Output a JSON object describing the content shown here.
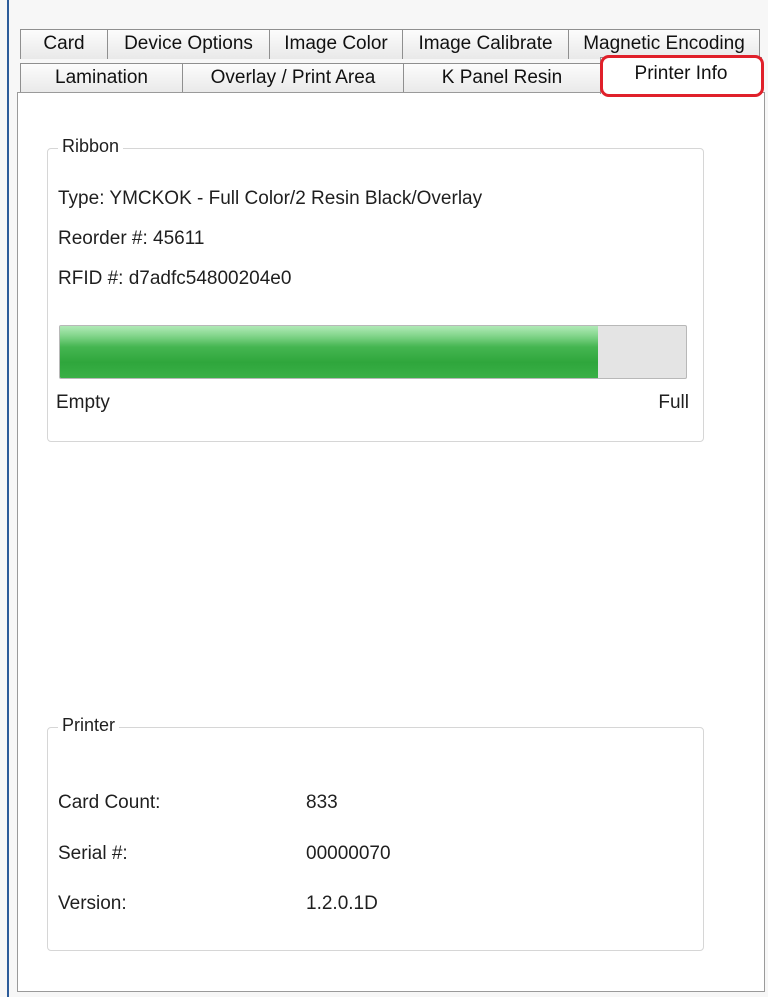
{
  "tabs": {
    "row1": [
      "Card",
      "Device Options",
      "Image Color",
      "Image Calibrate",
      "Magnetic Encoding"
    ],
    "row2": [
      "Lamination",
      "Overlay / Print Area",
      "K Panel Resin",
      "Printer Info"
    ],
    "selected": "Printer Info"
  },
  "ribbon": {
    "title": "Ribbon",
    "type": "Type: YMCKOK - Full Color/2 Resin Black/Overlay",
    "reorder": "Reorder #: 45611",
    "rfid": "RFID #: d7adfc54800204e0",
    "level_fraction": 0.86,
    "empty_label": "Empty",
    "full_label": "Full",
    "fill_color": "#3cb046"
  },
  "printer": {
    "title": "Printer",
    "card_count_label": "Card Count:",
    "card_count_value": "833",
    "serial_label": "Serial #:",
    "serial_value": "00000070",
    "version_label": "Version:",
    "version_value": "1.2.0.1D"
  },
  "colors": {
    "selection_highlight": "#e0202a",
    "window_edge": "#2d5c9a"
  }
}
